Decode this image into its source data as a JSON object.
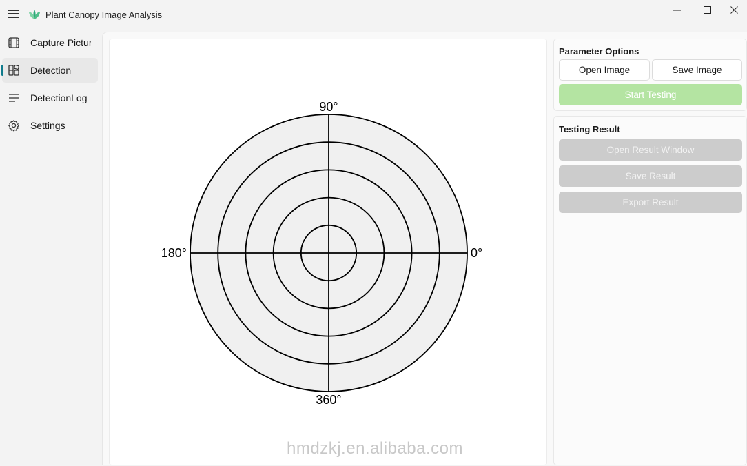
{
  "app": {
    "title": "Plant Canopy Image Analysis"
  },
  "sidebar": {
    "items": [
      {
        "label": "Capture Picture",
        "icon": "film-icon",
        "active": false
      },
      {
        "label": "Detection",
        "icon": "layout-grid-icon",
        "active": true
      },
      {
        "label": "DetectionLog",
        "icon": "list-lines-icon",
        "active": false
      },
      {
        "label": "Settings",
        "icon": "gear-icon",
        "active": false
      }
    ]
  },
  "polar": {
    "angle_labels": {
      "top": "90°",
      "left": "180°",
      "right": "0°",
      "bottom": "360°"
    },
    "ring_count": 5,
    "fill_color": "#f0f0f0",
    "line_color": "#000000"
  },
  "watermark": "hmdzkj.en.alibaba.com",
  "parameter_options": {
    "title": "Parameter Options",
    "open_image": "Open Image",
    "save_image": "Save Image",
    "start_testing": "Start Testing"
  },
  "testing_result": {
    "title": "Testing Result",
    "open_result_window": "Open Result Window",
    "save_result": "Save Result",
    "export_result": "Export Result"
  },
  "colors": {
    "accent": "#0f7b8c",
    "start_button": "#b4e4a2",
    "disabled_button": "#cccccc"
  }
}
